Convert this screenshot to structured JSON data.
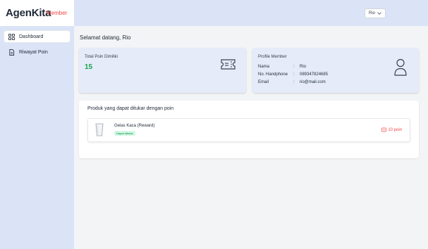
{
  "app": {
    "brand": "AgenKita",
    "brand_badge": "Member"
  },
  "header": {
    "user_menu_label": "Rio"
  },
  "sidebar": {
    "items": [
      {
        "label": "Dashboard",
        "icon": "dashboard-grid-icon",
        "active": true
      },
      {
        "label": "Riwayat Poin",
        "icon": "document-icon",
        "active": false
      }
    ]
  },
  "main": {
    "greeting": "Selamat datang, Rio",
    "points_card": {
      "label": "Total Poin Dimiliki",
      "value": "15",
      "icon": "ticket-icon"
    },
    "profile_card": {
      "title": "Profile Member",
      "rows": [
        {
          "key": "Nama",
          "sep": ":",
          "value": "Rio"
        },
        {
          "key": "No. Handphone",
          "sep": ":",
          "value": "089347824685"
        },
        {
          "key": "Email",
          "sep": ":",
          "value": "rio@mail.com"
        }
      ],
      "icon": "person-icon"
    },
    "products_panel": {
      "title": "Produk yang dapat ditukar dengan poin",
      "items": [
        {
          "name": "Gelas Kaca (Reward)",
          "badge": "Dapat ditukar",
          "points": "10 poin",
          "icon": "glass-icon"
        }
      ]
    }
  },
  "colors": {
    "accent_green": "#16a34a",
    "accent_red": "#ef4444",
    "sidebar_bg": "#dbe4f7",
    "card_bg": "#e5ebf9"
  }
}
